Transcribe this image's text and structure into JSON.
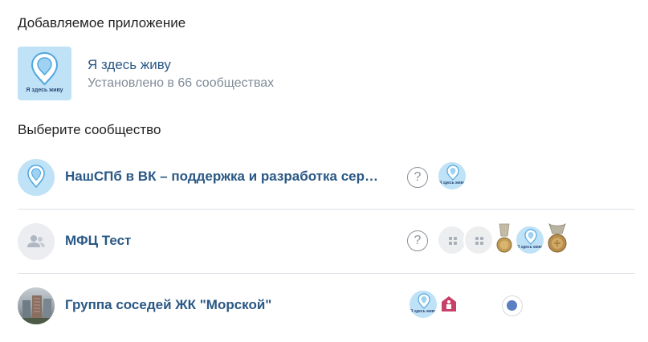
{
  "added_section": {
    "title": "Добавляемое приложение",
    "app": {
      "tile_caption": "Я здесь живу",
      "name": "Я здесь живу",
      "installs": "Установлено в 66 сообществах"
    }
  },
  "choose_section": {
    "title": "Выберите сообщество",
    "communities": [
      {
        "title": "НашСПб в ВК – поддержка и разработка сер…",
        "avatar": "pin-icon",
        "help": "?",
        "apps_caption": "Я здесь живу"
      },
      {
        "title": "МФЦ Тест",
        "avatar": "group-icon",
        "help": "?",
        "apps_caption": "Я здесь живу"
      },
      {
        "title": "Группа соседей ЖК \"Морской\"",
        "avatar": "photo",
        "apps_caption": "Я здесь живу"
      }
    ]
  },
  "colors": {
    "link": "#2a5885",
    "secondary": "#818c99",
    "tile_bg": "#bfe2f6",
    "divider": "#dce1e6",
    "accent_red": "#c7416b",
    "dot_blue": "#5b7fc2"
  }
}
